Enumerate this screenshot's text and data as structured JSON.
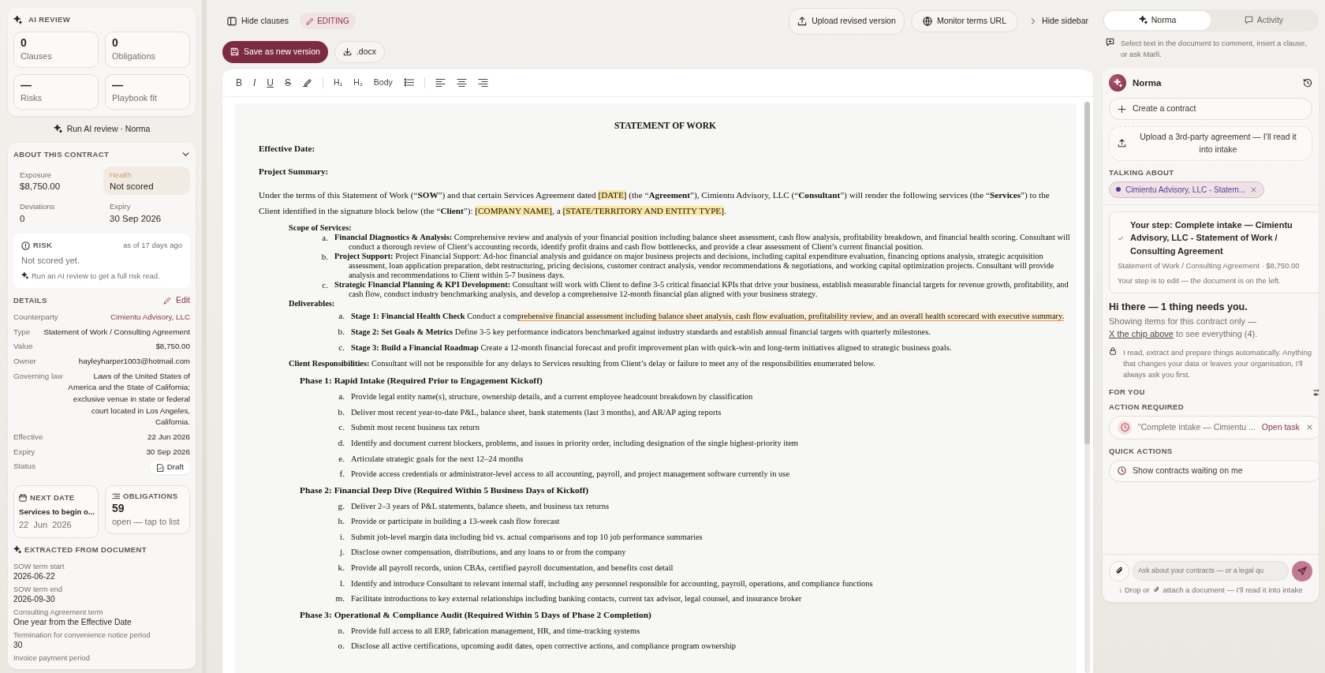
{
  "ai_review": {
    "title": "AI REVIEW",
    "stats": [
      {
        "value": "0",
        "label": "Clauses"
      },
      {
        "value": "0",
        "label": "Obligations"
      },
      {
        "value": "—",
        "label": "Risks"
      },
      {
        "value": "—",
        "label": "Playbook fit"
      }
    ],
    "run_button": "Run AI review · Norma"
  },
  "about": {
    "title": "ABOUT THIS CONTRACT",
    "expanded": true,
    "metrics": [
      {
        "label": "Exposure",
        "value": "$8,750.00",
        "highlighted": false
      },
      {
        "label": "Health",
        "value": "Not scored",
        "highlighted": true
      },
      {
        "label": "Deviations",
        "value": "0",
        "highlighted": false
      },
      {
        "label": "Expiry",
        "value": "30 Sep 2026",
        "highlighted": false
      }
    ],
    "risk": {
      "title": "RISK",
      "as_of": "as of 17 days ago",
      "text": "Not scored yet.",
      "hint": "Run an AI review to get a full risk read."
    },
    "details": {
      "title": "DETAILS",
      "edit": "Edit",
      "rows": [
        {
          "label": "Counterparty",
          "value": "Cimientu Advisory, LLC",
          "kind": "link"
        },
        {
          "label": "Type",
          "value": "Statement of Work / Consulting Agreement",
          "kind": "text"
        },
        {
          "label": "Value",
          "value": "$8,750.00",
          "kind": "text"
        },
        {
          "label": "Owner",
          "value": "hayleyharper1003@hotmail.com",
          "kind": "text"
        },
        {
          "label": "Governing law",
          "value": "Laws of the United States of America and the State of California; exclusive venue in state or federal court located in Los Angeles, California.",
          "kind": "text"
        },
        {
          "label": "Effective",
          "value": "22 Jun 2026",
          "kind": "text"
        },
        {
          "label": "Expiry",
          "value": "30 Sep 2026",
          "kind": "text"
        },
        {
          "label": "Status",
          "value": "Draft",
          "kind": "badge"
        }
      ]
    },
    "next_date": {
      "title": "NEXT DATE",
      "text": "Services to begin o...",
      "date": "22  Jun  2026"
    },
    "obligations": {
      "title": "OBLIGATIONS",
      "count": "59",
      "hint": "open — tap to list"
    },
    "extracted": {
      "title": "EXTRACTED FROM DOCUMENT",
      "items": [
        {
          "label": "SOW term start",
          "value": "2026-06-22"
        },
        {
          "label": "SOW term end",
          "value": "2026-09-30"
        },
        {
          "label": "Consulting Agreement term",
          "value": "One year from the Effective Date"
        },
        {
          "label": "Termination for convenience notice period",
          "value": "30"
        },
        {
          "label": "Invoice payment period"
        }
      ]
    }
  },
  "toolbar": {
    "hide_clauses": "Hide clauses",
    "mode": "EDITING",
    "upload": "Upload revised version",
    "monitor": "Monitor terms URL",
    "hide_sidebar": "Hide sidebar",
    "save": "Save as new version",
    "download": ".docx"
  },
  "format_bar": [
    {
      "kind": "bold",
      "label": "B"
    },
    {
      "kind": "italic",
      "label": "I"
    },
    {
      "kind": "underline",
      "label": "U"
    },
    {
      "kind": "strike",
      "label": "S"
    },
    {
      "kind": "highlight"
    },
    {
      "kind": "divider"
    },
    {
      "kind": "text",
      "label": "H₁"
    },
    {
      "kind": "text",
      "label": "H₂"
    },
    {
      "kind": "text",
      "label": "Body"
    },
    {
      "kind": "bullets"
    },
    {
      "kind": "divider"
    },
    {
      "kind": "align_left"
    },
    {
      "kind": "align_center"
    },
    {
      "kind": "align_right"
    }
  ],
  "document": {
    "title": "STATEMENT OF WORK",
    "blocks": [
      {
        "kind": "heading",
        "text": "Effective Date:"
      },
      {
        "kind": "heading",
        "text": "Project Summary:"
      },
      {
        "kind": "paragraph",
        "segments": [
          {
            "text": "Under the terms of this Statement of Work (“**SOW**”) and that certain Services Agreement dated "
          },
          {
            "text": "[DATE]",
            "kind": "placeholder"
          },
          {
            "text": " (the “**Agreement**”), Cimientu Advisory, LLC (“**Consultant**”) will render the following services (the “**Services**”) to the Client identified in the signature block below (the “**Client**”): "
          },
          {
            "text": "[COMPANY NAME]",
            "kind": "placeholder"
          },
          {
            "text": ", a "
          },
          {
            "text": "[STATE/TERRITORY AND ENTITY TYPE]",
            "kind": "placeholder"
          },
          {
            "text": "."
          }
        ]
      },
      {
        "kind": "label",
        "text": "Scope of Services:"
      },
      {
        "kind": "dense_item",
        "marker": "a.",
        "segments": [
          {
            "text": "**Financial Diagnostics & Analysis:** Comprehensive review and analysis of your financial position including balance sheet assessment, cash flow analysis, profitability breakdown, and financial health scoring. Consultant will conduct a thorough review of Client’s accounting records, identify profit drains and cash flow bottlenecks, and provide a clear assessment of Client’s current financial position."
          }
        ]
      },
      {
        "kind": "dense_item",
        "marker": "b.",
        "segments": [
          {
            "text": "**Project Support:** Project Financial Support: Ad-hoc financial analysis and guidance on major business projects and decisions, including capital expenditure evaluation, financing options analysis, strategic acquisition assessment, loan application preparation, debt restructuring, pricing decisions, customer contract analysis, vendor recommendations & negotiations, and working capital optimization projects. Consultant will provide analysis and recommendations to Client within 5-7 business days."
          }
        ]
      },
      {
        "kind": "dense_item",
        "marker": "c.",
        "segments": [
          {
            "text": "**Strategic Financial Planning & KPI Development:** Consultant will work with Client to define 3-5 critical financial KPIs that drive your business, establish measurable financial targets for revenue growth, profitability, and cash flow, conduct industry benchmarking analysis, and develop a comprehensive 12-month financial plan aligned with your business strategy."
          }
        ]
      },
      {
        "kind": "label",
        "text": "Deliverables:"
      },
      {
        "kind": "item",
        "marker": "a.",
        "segments": [
          {
            "text": "**Stage 1: Financial Health Check** Conduct a com"
          },
          {
            "text": "prehensive financial assessment including balance sheet analysis, cash flow evaluation, profitability review, and an overall health scorecard with executive summary.",
            "kind": "comment"
          }
        ]
      },
      {
        "kind": "item",
        "marker": "b.",
        "segments": [
          {
            "text": "**Stage 2: Set Goals & Metrics** Define 3-5 key performance indicators benchmarked against industry standards and establish annual financial targets with quarterly milestones."
          }
        ]
      },
      {
        "kind": "item",
        "marker": "c.",
        "segments": [
          {
            "text": "**Stage 3: Build a Financial Roadmap** Create a 12-month financial forecast and profit improvement plan with quick-win and long-term initiatives aligned to strategic business goals."
          }
        ]
      },
      {
        "kind": "label_paragraph",
        "segments": [
          {
            "text": "**Client Responsibilities:** Consultant will not be responsible for any delays to Services resulting from Client’s delay or failure to meet any of the responsibilities enumerated below."
          }
        ]
      },
      {
        "kind": "phase",
        "text": "Phase 1: Rapid Intake (Required Prior to Engagement Kickoff)"
      },
      {
        "kind": "item",
        "marker": "a.",
        "segments": [
          {
            "text": "Provide legal entity name(s), structure, ownership details, and a current employee headcount breakdown by classification"
          }
        ]
      },
      {
        "kind": "item",
        "marker": "b.",
        "segments": [
          {
            "text": "Deliver most recent year-to-date P&L, balance sheet, bank statements (last 3 months), and AR/AP aging reports"
          }
        ]
      },
      {
        "kind": "item",
        "marker": "c.",
        "segments": [
          {
            "text": "Submit most recent business tax return"
          }
        ]
      },
      {
        "kind": "item",
        "marker": "d.",
        "segments": [
          {
            "text": "Identify and document current blockers, problems, and issues in priority order, including designation of the single highest-priority item"
          }
        ]
      },
      {
        "kind": "item",
        "marker": "e.",
        "segments": [
          {
            "text": "Articulate strategic goals for the next 12–24 months"
          }
        ]
      },
      {
        "kind": "item",
        "marker": "f.",
        "segments": [
          {
            "text": "Provide access credentials or administrator-level access to all accounting, payroll, and project management software currently in use"
          }
        ]
      },
      {
        "kind": "phase",
        "text": "Phase 2: Financial Deep Dive (Required Within 5 Business Days of Kickoff)"
      },
      {
        "kind": "item",
        "marker": "g.",
        "segments": [
          {
            "text": "Deliver 2–3 years of P&L statements, balance sheets, and business tax returns"
          }
        ]
      },
      {
        "kind": "item",
        "marker": "h.",
        "segments": [
          {
            "text": "Provide or participate in building a 13-week cash flow forecast"
          }
        ]
      },
      {
        "kind": "item",
        "marker": "i.",
        "segments": [
          {
            "text": "Submit job-level margin data including bid vs. actual comparisons and top 10 job performance summaries"
          }
        ]
      },
      {
        "kind": "item",
        "marker": "j.",
        "segments": [
          {
            "text": "Disclose owner compensation, distributions, and any loans to or from the company"
          }
        ]
      },
      {
        "kind": "item",
        "marker": "k.",
        "segments": [
          {
            "text": "Provide all payroll records, union CBAs, certified payroll documentation, and benefits cost detail"
          }
        ]
      },
      {
        "kind": "item",
        "marker": "l.",
        "segments": [
          {
            "text": "Identify and introduce Consultant to relevant internal staff, including any personnel responsible for accounting, payroll, operations, and compliance functions"
          }
        ]
      },
      {
        "kind": "item",
        "marker": "m.",
        "segments": [
          {
            "text": "Facilitate introductions to key external relationships including banking contacts, current tax advisor, legal counsel, and insurance broker"
          }
        ]
      },
      {
        "kind": "phase",
        "text": "Phase 3: Operational & Compliance Audit (Required Within 5 Days of Phase 2 Completion)"
      },
      {
        "kind": "item",
        "marker": "n.",
        "segments": [
          {
            "text": "Provide full access to all ERP, fabrication management, HR, and time-tracking systems"
          }
        ]
      },
      {
        "kind": "item",
        "marker": "o.",
        "segments": [
          {
            "text": "Disclose all active certifications, upcoming audit dates, open corrective actions, and compliance program ownership"
          }
        ]
      }
    ]
  },
  "assistant": {
    "tabs": [
      {
        "label": "Norma",
        "selected": true
      },
      {
        "label": "Activity",
        "selected": false
      }
    ],
    "hint": "Select text in the document to comment, insert a clause, or ask Marli.",
    "name": "Norma",
    "create": "Create a contract",
    "upload": "Upload a 3rd-party agreement — I’ll read it into intake",
    "talking_about": "TALKING ABOUT",
    "chip": "Cimientu Advisory, LLC - Statem...",
    "step": {
      "title": "Your step: Complete intake — Cimientu Advisory, LLC - Statement of Work / Consulting Agreement",
      "meta": "Statement of Work / Consulting Agreement · $8,750.00",
      "note": "Your step is to edit — the document is on the left."
    },
    "greeting": "Hi there — 1 thing needs you.",
    "showing": "Showing items for this contract only — ",
    "showing_link": "X the chip above",
    "showing_tail": " to see everything (4).",
    "privacy": "I read, extract and prepare things automatically. Anything that changes your data or leaves your organisation, I’ll always ask you first.",
    "for_you": "FOR YOU",
    "action_required": "ACTION REQUIRED",
    "task": {
      "text": "“Complete intake — Cimientu ...",
      "action": "Open task"
    },
    "quick_actions": "QUICK ACTIONS",
    "quick": [
      "Show contracts waiting on me"
    ],
    "input_placeholder": "Ask about your contracts — or a legal qu",
    "footer_start": "↓ Drop or",
    "footer_end": "attach a document — I’ll read it into intake"
  }
}
